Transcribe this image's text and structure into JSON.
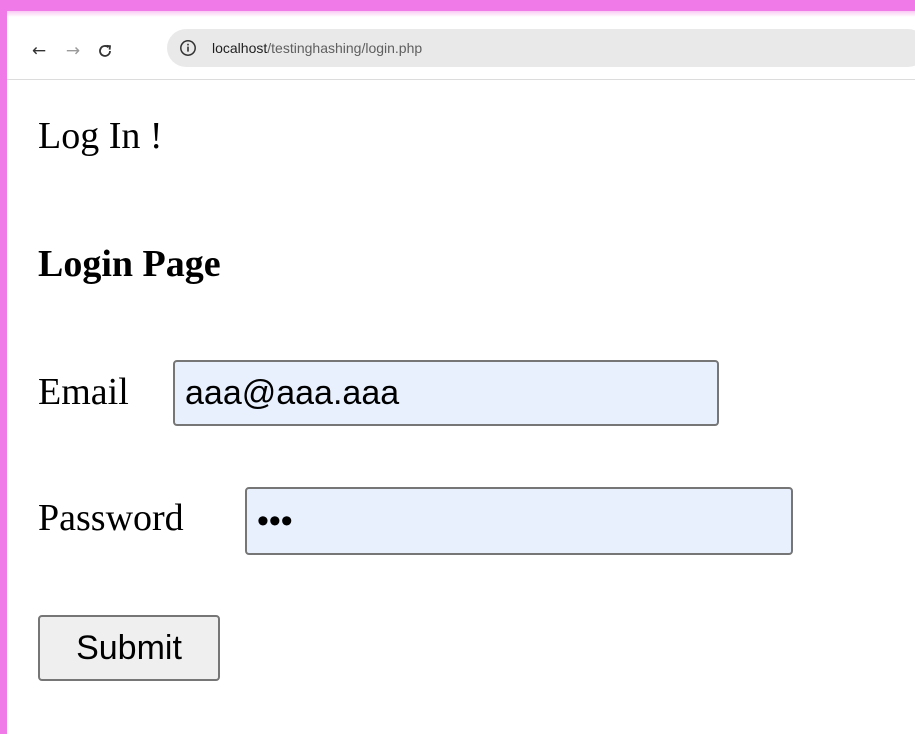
{
  "browser": {
    "back_icon": "arrow-left-icon",
    "forward_icon": "arrow-right-icon",
    "reload_icon": "reload-icon",
    "site_info_icon": "info-icon",
    "url_host": "localhost",
    "url_path": "/testinghashing/login.php"
  },
  "page": {
    "title": "Log In !",
    "heading": "Login Page"
  },
  "form": {
    "email_label": "Email",
    "email_value": "aaa@aaa.aaa",
    "password_label": "Password",
    "password_value": "aaa",
    "submit_label": "Submit"
  },
  "colors": {
    "window_border": "#f07ae8",
    "autofill_background": "#e8f0fe",
    "button_background": "#efefef"
  }
}
